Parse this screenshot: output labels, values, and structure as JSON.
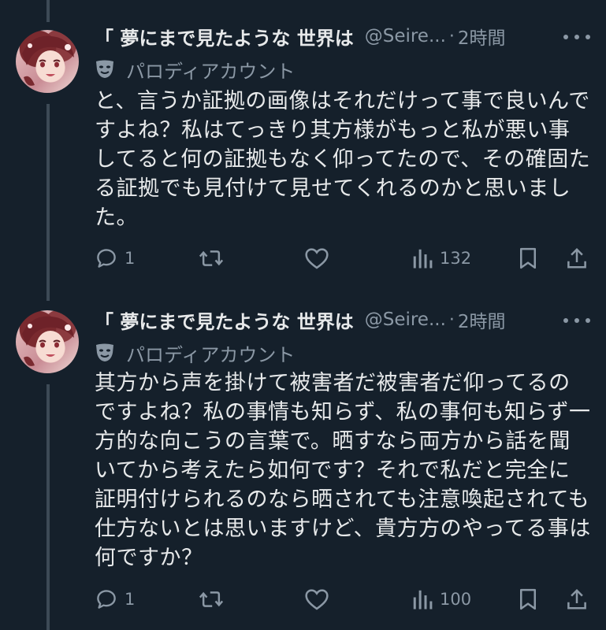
{
  "tweets": [
    {
      "name": "「 夢にまで見たような 世界は",
      "handle": "@Seire...",
      "dot": "·",
      "time": "2時間",
      "parody_label": "パロディアカウント",
      "text": "と、言うか証拠の画像はそれだけって事で良いんですよね？私はてっきり其方様がもっと私が悪い事してると何の証拠もなく仰ってたので、その確固たる証拠でも見付けて見せてくれるのかと思いました。",
      "replies": "1",
      "views": "132"
    },
    {
      "name": "「 夢にまで見たような 世界は",
      "handle": "@Seire...",
      "dot": "·",
      "time": "2時間",
      "parody_label": "パロディアカウント",
      "text": "其方から声を掛けて被害者だ被害者だ仰ってるのですよね？私の事情も知らず、私の事何も知らず一方的な向こうの言葉で。晒すなら両方から話を聞いてから考えたら如何です？それで私だと完全に証明付けられるのなら晒されても注意喚起されても仕方ないとは思いますけど、貴方方のやってる事は何ですか？",
      "replies": "1",
      "views": "100"
    }
  ],
  "icons": {
    "more": "more-horizontal-icon",
    "parody": "theater-mask-icon",
    "reply": "reply-bubble-icon",
    "retweet": "retweet-arrows-icon",
    "like": "heart-icon",
    "views": "bar-chart-icon",
    "bookmark": "bookmark-icon",
    "share": "share-upload-icon"
  },
  "colors": {
    "background": "#15202b",
    "text": "#e7e9ea",
    "muted": "#8b98a5",
    "thread_line": "#3d4a56"
  }
}
